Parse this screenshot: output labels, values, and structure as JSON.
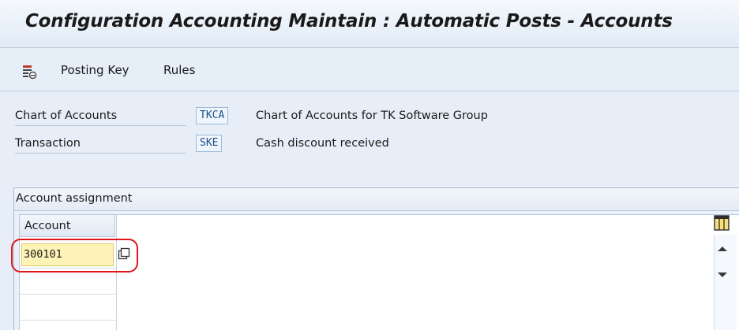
{
  "window": {
    "title": "Configuration Accounting Maintain : Automatic Posts - Accounts"
  },
  "toolbar": {
    "icon": "list-settings-icon",
    "posting_key_label": "Posting Key",
    "rules_label": "Rules"
  },
  "header": {
    "chart_of_accounts": {
      "label": "Chart of Accounts",
      "code": "TKCA",
      "description": "Chart of Accounts for TK Software Group"
    },
    "transaction": {
      "label": "Transaction",
      "code": "SKE",
      "description": "Cash discount received"
    }
  },
  "account_assignment": {
    "group_title": "Account assignment",
    "columns": [
      "Account"
    ],
    "rows": [
      {
        "account": "300101"
      }
    ],
    "highlight_color": "#e0161b",
    "input_bg_color": "#fdf3b6"
  }
}
